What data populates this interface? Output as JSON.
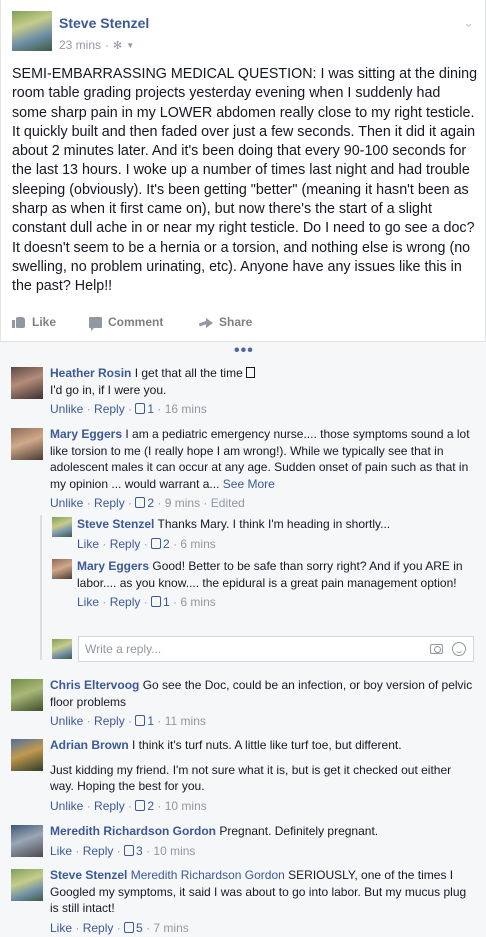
{
  "post": {
    "author": "Steve Stenzel",
    "time": "23 mins",
    "privacy_icon": "gear-icon",
    "text": "SEMI-EMBARRASSING MEDICAL QUESTION: I was sitting at the dining room table grading projects yesterday evening when I suddenly had some sharp pain in my LOWER abdomen really close to my right testicle. It quickly built and then faded over just a few seconds. Then it did it again about 2 minutes later. And it's been doing that every 90-100 seconds for the last 13 hours. I woke up a number of times last night and had trouble sleeping (obviously). It's been getting \"better\" (meaning it hasn't been as sharp as when it first came on), but now there's the start of a slight constant dull ache in or near my right testicle. Do I need to go see a doc? It doesn't seem to be a hernia or a torsion, and nothing else is wrong (no swelling, no problem urinating, etc). Anyone have any issues like this in the past? Help!!"
  },
  "actions": {
    "like": "Like",
    "comment": "Comment",
    "share": "Share"
  },
  "more": "•••",
  "labels": {
    "unlike": "Unlike",
    "like": "Like",
    "reply": "Reply",
    "sep": " · ",
    "edited": "Edited",
    "see_more": "See More"
  },
  "comments": [
    {
      "name": "Heather Rosin",
      "text1": "I get that all the time",
      "text2": "I'd go in, if I were you.",
      "likes": "1",
      "time": "16 mins"
    },
    {
      "name": "Mary Eggers",
      "text": "I am a pediatric emergency nurse.... those symptoms sound a lot like torsion to me (I really hope I am wrong!). While we typically see that in adolescent males it can occur at any age. Sudden onset of pain such as that in my opinion ... would warrant a...",
      "likes": "2",
      "time": "9 mins"
    },
    {
      "name": "Chris Eltervoog",
      "text": "Go see the Doc, could be an infection, or boy version of pelvic floor problems",
      "likes": "1",
      "time": "11 mins"
    },
    {
      "name": "Adrian Brown",
      "text1": "I think it's turf nuts. A little like turf toe, but different.",
      "text2": "Just kidding my friend. I'm not sure what it is, but is get it checked out either way. Hoping the best for you.",
      "likes": "2",
      "time": "10 mins"
    },
    {
      "name": "Meredith Richardson Gordon",
      "text": "Pregnant. Definitely pregnant.",
      "likes": "3",
      "time": "10 mins"
    },
    {
      "name": "Steve Stenzel",
      "tag": "Meredith Richardson Gordon",
      "text": "SERIOUSLY, one of the times I Googled my symptoms, it said I was about to go into labor. But my mucus plug is still intact!",
      "likes": "5",
      "time": "7 mins"
    }
  ],
  "replies": [
    {
      "name": "Steve Stenzel",
      "text": "Thanks Mary. I think I'm heading in shortly...",
      "likes": "2",
      "time": "6 mins"
    },
    {
      "name": "Mary Eggers",
      "text": "Good! Better to be safe than sorry right? And if you ARE in labor.... as you know.... the epidural is a great pain management option!",
      "likes": "1",
      "time": "6 mins"
    }
  ],
  "reply_input": {
    "placeholder": "Write a reply..."
  }
}
